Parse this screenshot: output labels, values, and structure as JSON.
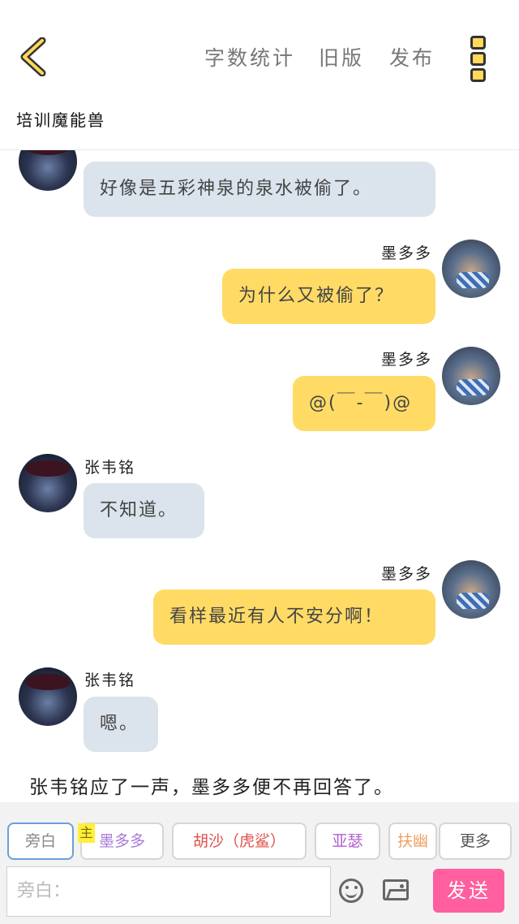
{
  "header": {
    "actions": [
      "字数统计",
      "旧版",
      "发布"
    ],
    "book_title": "培训魔能兽"
  },
  "messages": [
    {
      "side": "left",
      "name": "",
      "text": "好像是五彩神泉的泉水被偷了。"
    },
    {
      "side": "right",
      "name": "墨多多",
      "text": "为什么又被偷了？"
    },
    {
      "side": "right",
      "name": "墨多多",
      "text": "@(￣-￣)@"
    },
    {
      "side": "left",
      "name": "张韦铭",
      "text": "不知道。"
    },
    {
      "side": "right",
      "name": "墨多多",
      "text": "看样最近有人不安分啊！"
    },
    {
      "side": "left",
      "name": "张韦铭",
      "text": "嗯。"
    }
  ],
  "narration": "张韦铭应了一声，墨多多便不再回答了。",
  "roles": {
    "items": [
      {
        "label": "旁白",
        "color": "#888888"
      },
      {
        "label": "墨多多",
        "color": "#a879d6"
      },
      {
        "label": "胡沙（虎鲨）",
        "color": "#e0504a"
      },
      {
        "label": "亚瑟",
        "color": "#b25fd0"
      },
      {
        "label": "扶幽",
        "color": "#f0a060"
      }
    ],
    "more": "更多",
    "host_badge": "主"
  },
  "composer": {
    "placeholder": "旁白：",
    "send": "发送"
  }
}
